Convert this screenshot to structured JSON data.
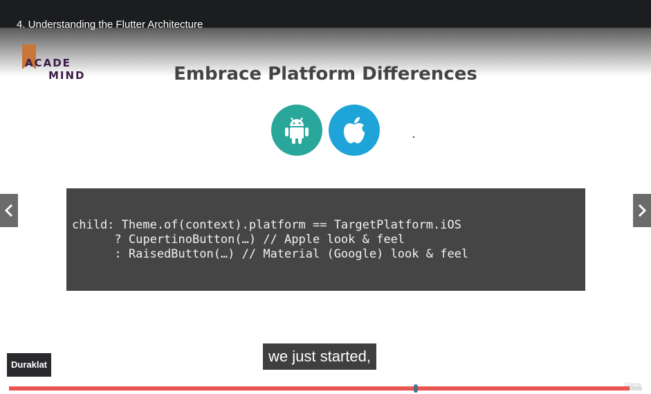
{
  "player": {
    "video_title": "4. Understanding the Flutter Architecture",
    "caption": "we just started,",
    "pause_tooltip": "Duraklat",
    "progress": 0.98
  },
  "slide": {
    "logo_line1": "ACADE",
    "logo_line2": "MIND",
    "title": "Embrace Platform Differences",
    "icons": [
      "android-icon",
      "apple-icon"
    ],
    "code": [
      "child: Theme.of(context).platform == TargetPlatform.iOS",
      "      ? CupertinoButton(…) // Apple look & feel",
      "      : RaisedButton(…) // Material (Google) look & feel"
    ]
  },
  "colors": {
    "top_bar": "#1c1d1f",
    "android": "#2aa79b",
    "apple": "#1ea4d8",
    "code_bg": "#454545",
    "progress": "#e9564f",
    "logo": "#3a1a48"
  }
}
